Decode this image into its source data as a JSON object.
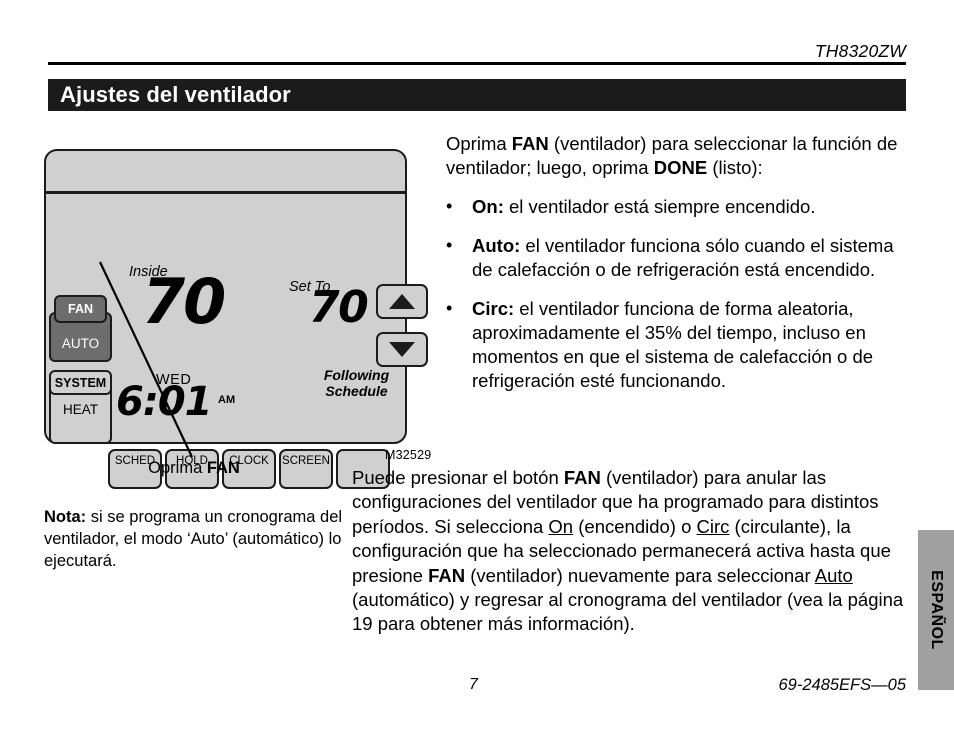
{
  "header": {
    "model": "TH8320ZW",
    "section_title": "Ajustes del ventilador"
  },
  "thermostat": {
    "inside_label": "Inside",
    "inside_temp": "70",
    "set_to_label": "Set To",
    "set_to_temp": "70",
    "day": "WED",
    "time": "6:01",
    "am_pm": "AM",
    "status": "Following\nSchedule",
    "status_line1": "Following",
    "status_line2": "Schedule",
    "side_buttons": [
      {
        "label": "FAN",
        "active": true
      },
      {
        "label": "AUTO",
        "active": true
      },
      {
        "label": "SYSTEM",
        "active": false
      },
      {
        "label": "HEAT",
        "active": false
      }
    ],
    "bottom_buttons": [
      "SCHED",
      "HOLD",
      "CLOCK",
      "SCREEN",
      ""
    ],
    "arrow_up": "▲",
    "arrow_down": "▼",
    "figure_code": "M32529",
    "caption_plain": "Oprima ",
    "caption_bold": "FAN"
  },
  "note": {
    "label": "Nota:",
    "text": " si se programa un cronograma del ventilador, el modo ‘Auto’ (automático) lo ejecutará."
  },
  "right_column": {
    "intro_part1": "Oprima ",
    "intro_bold1": "FAN",
    "intro_part2": " (ventilador) para seleccionar la función de ventilador; luego, oprima ",
    "intro_bold2": "DONE",
    "intro_part3": " (listo):",
    "bullets": [
      {
        "marker": "•",
        "term": "On:",
        "text": " el ventilador está siempre encendido."
      },
      {
        "marker": "•",
        "term": "Auto:",
        "text": " el ventilador funciona sólo cuando el sistema de calefacción o de refrigeración está encendido."
      },
      {
        "marker": "•",
        "term": "Circ:",
        "text": " el ventilador funciona de forma aleatoria, aproximadamente el 35% del tiempo, incluso en momentos en que el sistema de calefacción o de refrigeración esté funcionando."
      }
    ]
  },
  "lower_paragraph": {
    "p1": "Puede presionar el botón ",
    "b1": "FAN",
    "p2": " (ventilador) para anular las configuraciones del ventilador que ha programado para distintos períodos. Si selecciona ",
    "u1": "On",
    "p3": " (encendido) o ",
    "u2": "Circ",
    "p4": " (circulante), la configuración que ha seleccionado permanecerá activa hasta que presione ",
    "b2": "FAN",
    "p5": " (ventilador) nuevamente para seleccionar ",
    "u3": "Auto",
    "p6": " (automático) y regresar al cronograma del ventilador (vea la página 19 para obtener más información)."
  },
  "footer": {
    "page_number": "7",
    "doc_number": "69-2485EFS—05",
    "language_tab": "ESPAÑOL"
  },
  "colors": {
    "title_bar": "#1b1b1b",
    "body_gray": "#d0d0d0",
    "active_button": "#6d6d6d",
    "tab_gray": "#a0a0a0"
  }
}
